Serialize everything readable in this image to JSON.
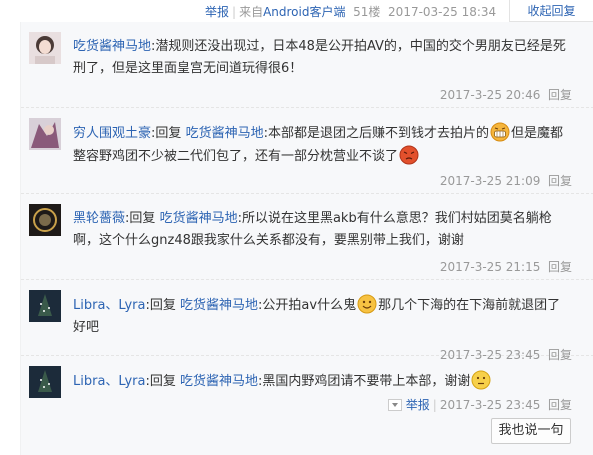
{
  "top": {
    "report": "举报",
    "from_prefix": "来自",
    "client": "Android客户端",
    "floor": "51楼",
    "time": "2017-03-25 18:34",
    "collapse": "收起回复"
  },
  "reply_word": "回复",
  "comments": [
    {
      "user": "吃货酱神马地",
      "segments": [
        {
          "type": "text",
          "value": ":潜规则还没出现过，日本48是公开拍AV的，中国的交个男朋友已经是死刑了，但是这里面皇宫无间道玩得很6！"
        }
      ],
      "time": "2017-3-25 20:46",
      "reply": "回复"
    },
    {
      "user": "穷人围观土豪",
      "reply_to": "吃货酱神马地",
      "segments": [
        {
          "type": "text",
          "value": ":本部都是退团之后赚不到钱才去拍片的"
        },
        {
          "type": "emoji",
          "name": "grin-emoji"
        },
        {
          "type": "text",
          "value": "但是魔都整容野鸡团不少被二代们包了，还有一部分枕营业不谈了"
        },
        {
          "type": "emoji",
          "name": "angry-emoji"
        }
      ],
      "time": "2017-3-25 21:09",
      "reply": "回复"
    },
    {
      "user": "黑轮薔薇",
      "reply_to": "吃货酱神马地",
      "segments": [
        {
          "type": "text",
          "value": ":所以说在这里黑akb有什么意思？我们村姑团莫名躺枪啊，这个什么gnz48跟我家什么关系都没有，要黑别带上我们，谢谢"
        }
      ],
      "time": "2017-3-25 21:15",
      "reply": "回复"
    },
    {
      "user": "Libra、Lyra",
      "reply_to": "吃货酱神马地",
      "segments": [
        {
          "type": "text",
          "value": ":公开拍av什么鬼"
        },
        {
          "type": "emoji",
          "name": "smile-emoji"
        },
        {
          "type": "text",
          "value": "那几个下海的在下海前就退团了好吧"
        }
      ],
      "time": "2017-3-25 23:45",
      "reply": "回复"
    },
    {
      "user": "Libra、Lyra",
      "reply_to": "吃货酱神马地",
      "segments": [
        {
          "type": "text",
          "value": ":黑国内野鸡团请不要带上本部，谢谢"
        },
        {
          "type": "emoji",
          "name": "speechless-emoji"
        }
      ],
      "time": "2017-3-25 23:45",
      "reply": "回复",
      "report": "举报"
    }
  ],
  "say_button": "我也说一句"
}
